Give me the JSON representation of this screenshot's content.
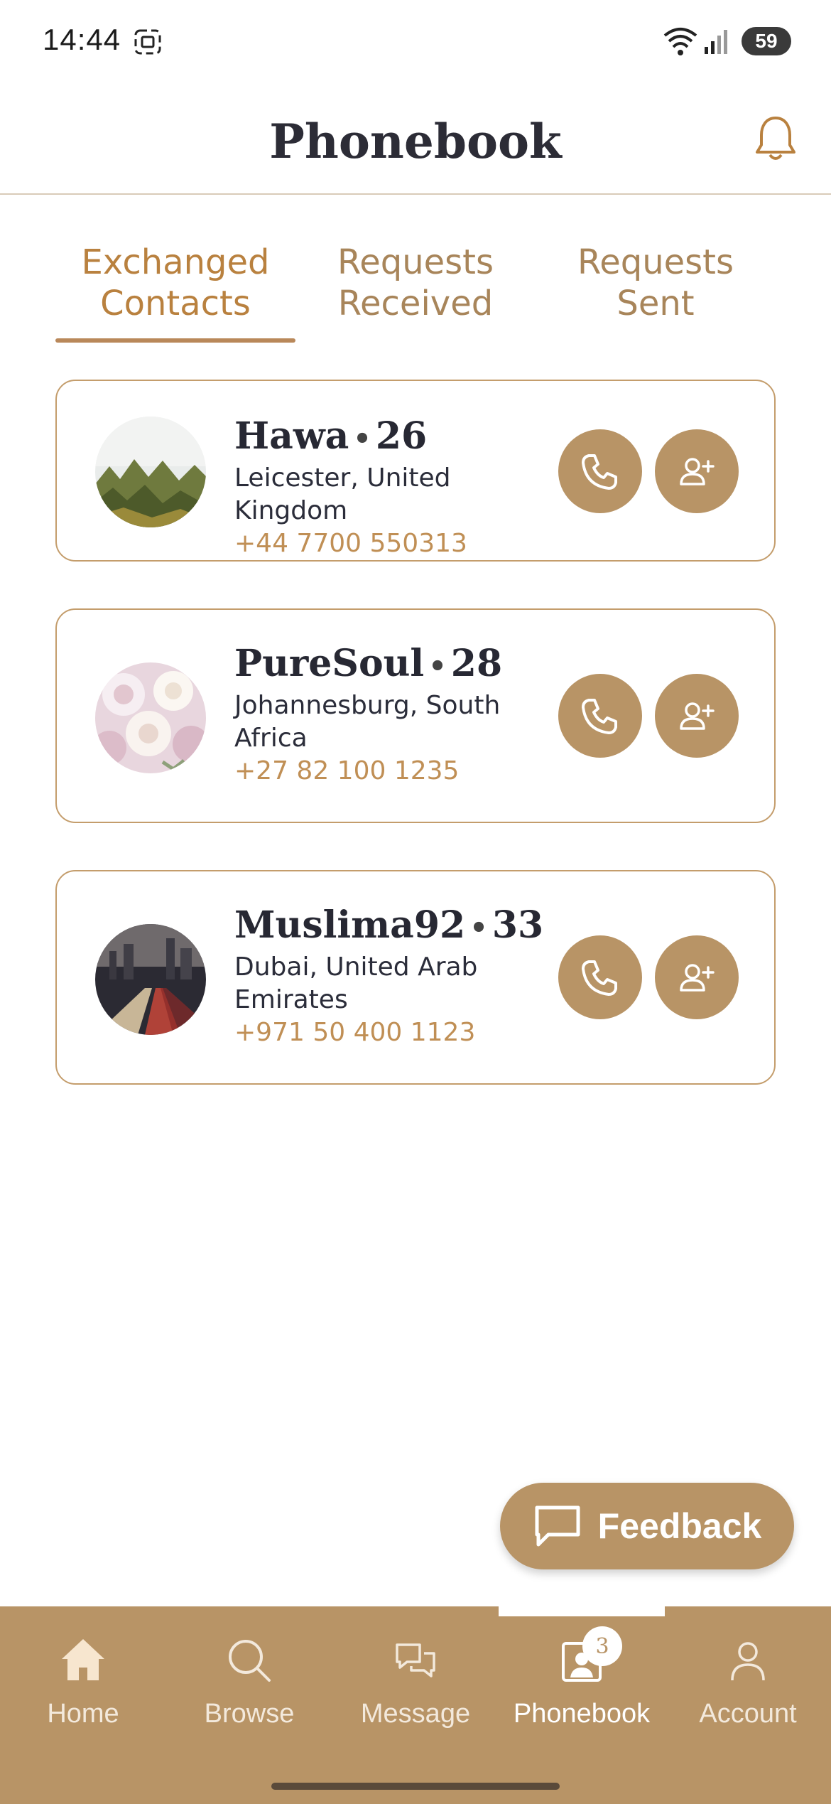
{
  "status_bar": {
    "time": "14:44",
    "battery": "59"
  },
  "header": {
    "title": "Phonebook",
    "bell_icon": "bell-icon"
  },
  "tabs": [
    {
      "line1": "Exchanged",
      "line2": "Contacts",
      "active": true
    },
    {
      "line1": "Requests",
      "line2": "Received",
      "active": false
    },
    {
      "line1": "Requests",
      "line2": "Sent",
      "active": false
    }
  ],
  "contacts": [
    {
      "name": "Hawa",
      "age": "26",
      "location": "Leicester, United Kingdom",
      "phone": "+44 7700 550313"
    },
    {
      "name": "PureSoul",
      "age": "28",
      "location": "Johannesburg, South Africa",
      "phone": "+27 82 100 1235"
    },
    {
      "name": "Muslima92",
      "age": "33",
      "location": "Dubai, United Arab Emirates",
      "phone": "+971 50 400 1123"
    }
  ],
  "feedback": {
    "label": "Feedback"
  },
  "bottom_nav": {
    "items": [
      {
        "label": "Home",
        "icon": "home-icon"
      },
      {
        "label": "Browse",
        "icon": "search-icon"
      },
      {
        "label": "Message",
        "icon": "chat-icon"
      },
      {
        "label": "Phonebook",
        "icon": "phonebook-icon",
        "badge": "3",
        "active": true
      },
      {
        "label": "Account",
        "icon": "user-icon"
      }
    ]
  },
  "colors": {
    "accent": "#b89466",
    "accent_text": "#c08f55",
    "title": "#2c2c36"
  }
}
